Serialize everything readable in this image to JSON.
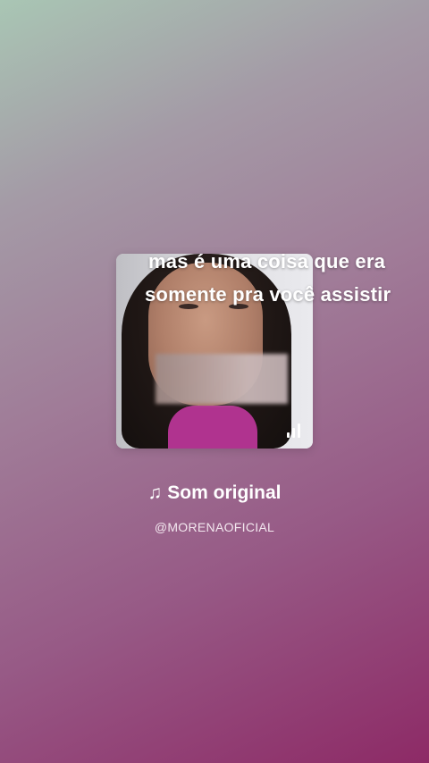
{
  "video": {
    "caption_lines": [
      "mas é uma coisa que era",
      "somente pra você assistir"
    ],
    "playing_indicator_icon": "audio-bars-icon"
  },
  "sound": {
    "icon": "music-note-icon",
    "title": "Som original",
    "author": "@MORENAOFICIAL"
  }
}
